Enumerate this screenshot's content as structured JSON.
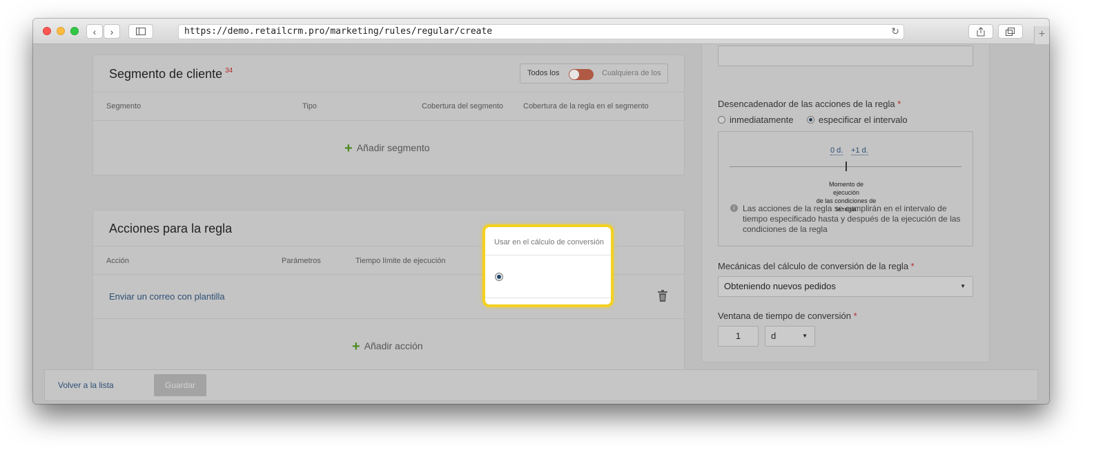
{
  "browser": {
    "url": "https://demo.retailcrm.pro/marketing/rules/regular/create",
    "reload_icon": "↻",
    "newtab_icon": "+"
  },
  "segment_panel": {
    "title": "Segmento de cliente",
    "count": "34",
    "toggle_left": "Todos los",
    "toggle_right": "Cualquiera de los",
    "columns": [
      "Segmento",
      "Tipo",
      "Cobertura del segmento",
      "Cobertura de la regla en el segmento"
    ],
    "add_label": "Añadir segmento"
  },
  "actions_panel": {
    "title": "Acciones para la regla",
    "columns": [
      "Acción",
      "Parámetros",
      "Tiempo límite de ejecución"
    ],
    "rows": [
      {
        "action": "Enviar un correo con plantilla"
      }
    ],
    "add_label": "Añadir acción"
  },
  "popup": {
    "header": "Usar en el cálculo de conversión",
    "selected": true
  },
  "trigger": {
    "label": "Desencadenador de las acciones de la regla",
    "required": "*",
    "option_immediate": "inmediatamente",
    "option_interval": "especificar el intervalo",
    "selected": "especificar el intervalo",
    "range_start": "0 d.",
    "range_end": "+1 d.",
    "marker_label_1": "Momento de",
    "marker_label_2": "ejecución",
    "marker_label_3": "de las condiciones de",
    "marker_label_4": "la regla",
    "info": "Las acciones de la regla se cumplirán en el intervalo de tiempo especificado hasta y después de la ejecución de las condiciones de la regla"
  },
  "conversion": {
    "mechanics_label": "Mecánicas del cálculo de conversión de la regla",
    "mechanics_value": "Obteniendo nuevos pedidos",
    "window_label": "Ventana de tiempo de conversión",
    "window_value": "1",
    "window_unit": "d",
    "required": "*"
  },
  "footer": {
    "back_label": "Volver a la lista",
    "save_label": "Guardar"
  }
}
